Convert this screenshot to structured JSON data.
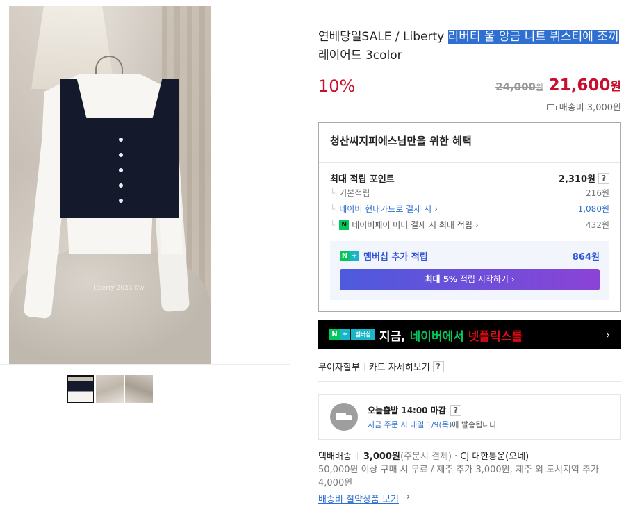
{
  "product": {
    "title_plain": "연베당일SALE / Liberty ",
    "title_highlight": "리버티 울 앙금 니트 뷔스티에 조끼",
    "title_rest": " 레이어드 3color",
    "watermark": "liberty 2023 f/w",
    "discount": "10%",
    "original_price": "24,000",
    "original_unit": "원",
    "sale_price": "21,600",
    "sale_unit": "원",
    "shipping_fee": "배송비 3,000원"
  },
  "benefit": {
    "title": "청산씨지피에스님만을 위한 혜택",
    "max_points_label": "최대 적립 포인트",
    "max_points_value": "2,310원",
    "help": "?",
    "basic_label": "기본적립",
    "basic_value": "216원",
    "hyundai_label": "네이버 현대카드로 결제 시",
    "hyundai_value": "1,080원",
    "npay_label": "네이버페이 머니 결제 시 최대 적립",
    "npay_value": "432원",
    "npay_icon": "N",
    "chevron": "›",
    "member_label": "멤버십 추가 적립",
    "member_value": "864원",
    "member_btn_pre": "최대 5%",
    "member_btn_post": " 적립 시작하기 ›",
    "nplus_n": "N",
    "nplus_p": "+"
  },
  "banner": {
    "n": "N",
    "p": "+",
    "membership": "멤버십",
    "text_1": "지금, ",
    "text_2": "네이버에서 ",
    "text_3": "넷플릭스를",
    "arrow": "›"
  },
  "card": {
    "installment": "무이자할부",
    "card_detail": "카드 자세히보기",
    "help": "?"
  },
  "shipping": {
    "title": "오늘출발 14:00 마감",
    "help": "?",
    "desc_blue": "지금 주문 시 내일",
    "desc_date": "1/9(목)",
    "desc_rest": "에 발송됩니다."
  },
  "delivery": {
    "type": "택배배송",
    "fee": "3,000원",
    "payment": "(주문시 결제)",
    "carrier": "· CJ 대한통운(오네)",
    "note": "50,000원 이상 구매 시 무료 / 제주 추가 3,000원, 제주 외 도서지역 추가 4,000원",
    "save_link": "배송비 절약상품 보기",
    "chevron": "›"
  },
  "colors": {
    "accent_red": "#c8102e",
    "naver_green": "#03c75a",
    "link_blue": "#2f6fcf"
  }
}
